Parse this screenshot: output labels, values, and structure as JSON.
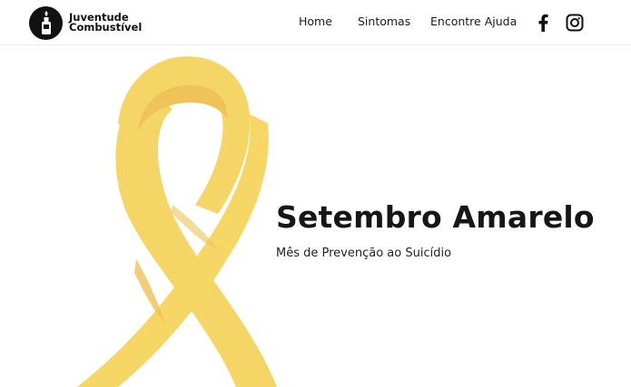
{
  "brand": {
    "line1": "Juventude",
    "line2": "Combustível",
    "logo_icon": "bottle-molotov-icon"
  },
  "nav": {
    "items": [
      {
        "label": "Home"
      },
      {
        "label": "Sintomas"
      },
      {
        "label": "Encontre Ajuda"
      }
    ]
  },
  "social": {
    "facebook_icon": "facebook-icon",
    "instagram_icon": "instagram-icon"
  },
  "hero": {
    "title": "Setembro Amarelo",
    "subtitle": "Mês de Prevenção ao Suicídio",
    "ribbon_color": "#F5D565",
    "ribbon_shadow_color": "#EFC25A"
  }
}
